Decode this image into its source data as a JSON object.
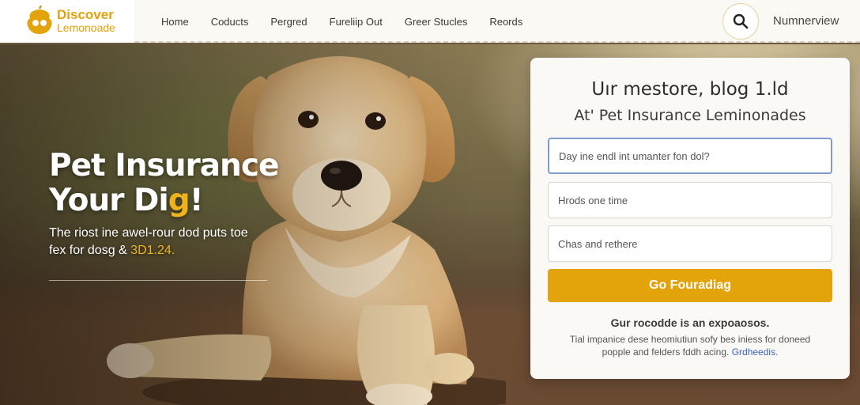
{
  "brand": {
    "name_line1": "Discover",
    "name_line2": "Lemonoade",
    "accent_color": "#e2a30b"
  },
  "nav": {
    "items": [
      {
        "label": "Home"
      },
      {
        "label": "Coducts"
      },
      {
        "label": "Pergred"
      },
      {
        "label": "Fureliip Out"
      },
      {
        "label": "Greer Stucles"
      },
      {
        "label": "Reords"
      }
    ],
    "search_icon": "search-icon",
    "account_label": "Numnerview"
  },
  "hero": {
    "title_line1": "Pet Insurance",
    "title_line2_main": "Your Di",
    "title_line2_accent": "g",
    "title_line2_end": "!",
    "desc_main": "The riost ine awel-rour dod puts toe fex for dosg & ",
    "desc_accent": "3D1.24."
  },
  "form": {
    "title": "Uır mestore, blog 1.ld",
    "subtitle": "At' Pet Insurance Leminonades",
    "fields": [
      {
        "placeholder": "Day ine endl int umanter fon dol?"
      },
      {
        "placeholder": "Hrods one time"
      },
      {
        "placeholder": "Chas and rethere"
      }
    ],
    "cta_label": "Go Fouradiag",
    "note": "Gur rocodde is an expoaosos.",
    "fine_print": "Tial impanice dese heomiutiun sofy bes iniess for doneed popple and felders fddh acing. ",
    "fine_link": "Grdheedis."
  }
}
